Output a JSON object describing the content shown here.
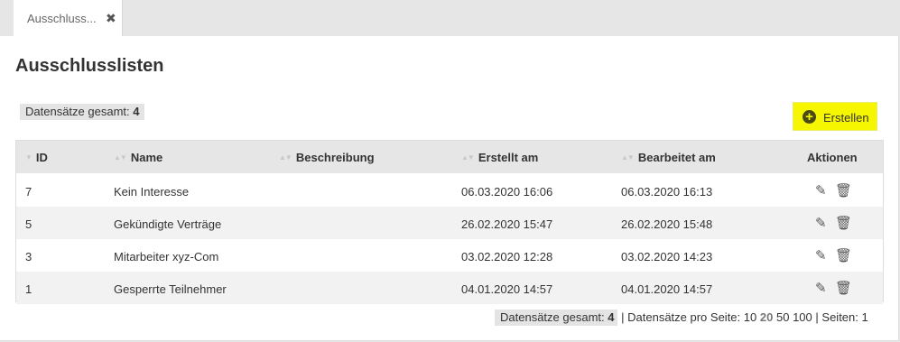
{
  "tab": {
    "label": "Ausschluss...",
    "close": "✖"
  },
  "page": {
    "title": "Ausschlusslisten"
  },
  "count": {
    "label": "Datensätze gesamt:",
    "value": "4"
  },
  "create_button": {
    "icon": "plus-circle-icon",
    "label": "Erstellen"
  },
  "columns": {
    "id": "ID",
    "name": "Name",
    "description": "Beschreibung",
    "created": "Erstellt am",
    "edited": "Bearbeitet am",
    "actions": "Aktionen"
  },
  "rows": [
    {
      "id": "7",
      "name": "Kein Interesse",
      "description": "",
      "created": "06.03.2020 16:06",
      "edited": "06.03.2020 16:13"
    },
    {
      "id": "5",
      "name": "Gekündigte Verträge",
      "description": "",
      "created": "26.02.2020 15:47",
      "edited": "26.02.2020 15:48"
    },
    {
      "id": "3",
      "name": "Mitarbeiter xyz-Com",
      "description": "",
      "created": "03.02.2020 12:28",
      "edited": "03.02.2020 14:23"
    },
    {
      "id": "1",
      "name": "Gesperrte Teilnehmer",
      "description": "",
      "created": "04.01.2020 14:57",
      "edited": "04.01.2020 14:57"
    }
  ],
  "row_icons": {
    "edit": "✎",
    "delete": "🗑"
  },
  "pager": {
    "total_label": "Datensätze gesamt:",
    "total_value": "4",
    "sep1": "|",
    "per_page_label": "Datensätze pro Seite:",
    "per_page_options": [
      "10",
      "20",
      "50",
      "100"
    ],
    "selected_per_page": "20",
    "sep2": "|",
    "pages_label": "Seiten:",
    "pages_value": "1"
  },
  "colors": {
    "accent": "#f6f600",
    "header_bg": "#e6e6e6",
    "alt_row": "#f2f2f2"
  }
}
